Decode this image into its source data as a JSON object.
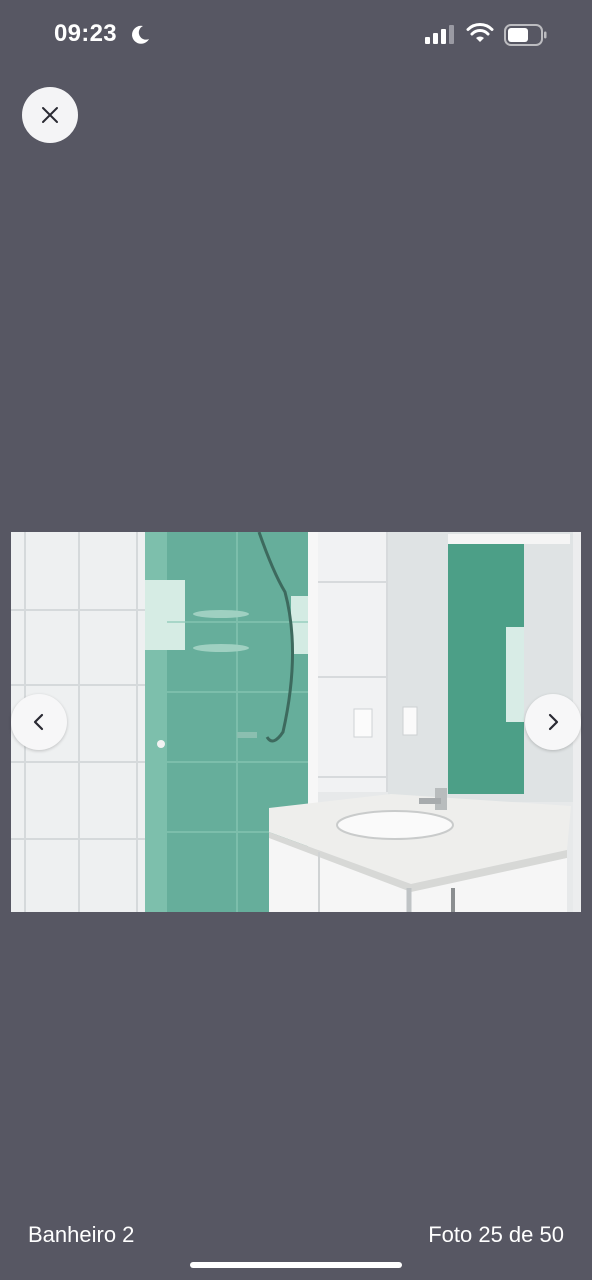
{
  "status_bar": {
    "time": "09:23",
    "icons": [
      "moon-icon",
      "cellular-signal-icon",
      "wifi-icon",
      "battery-icon"
    ]
  },
  "viewer": {
    "close_icon": "close-icon",
    "prev_icon": "chevron-left-icon",
    "next_icon": "chevron-right-icon",
    "caption": "Banheiro 2",
    "counter": "Foto 25 de 50"
  },
  "colors": {
    "background": "#575763",
    "button_bg": "#f4f4f6",
    "text": "#ffffff"
  }
}
